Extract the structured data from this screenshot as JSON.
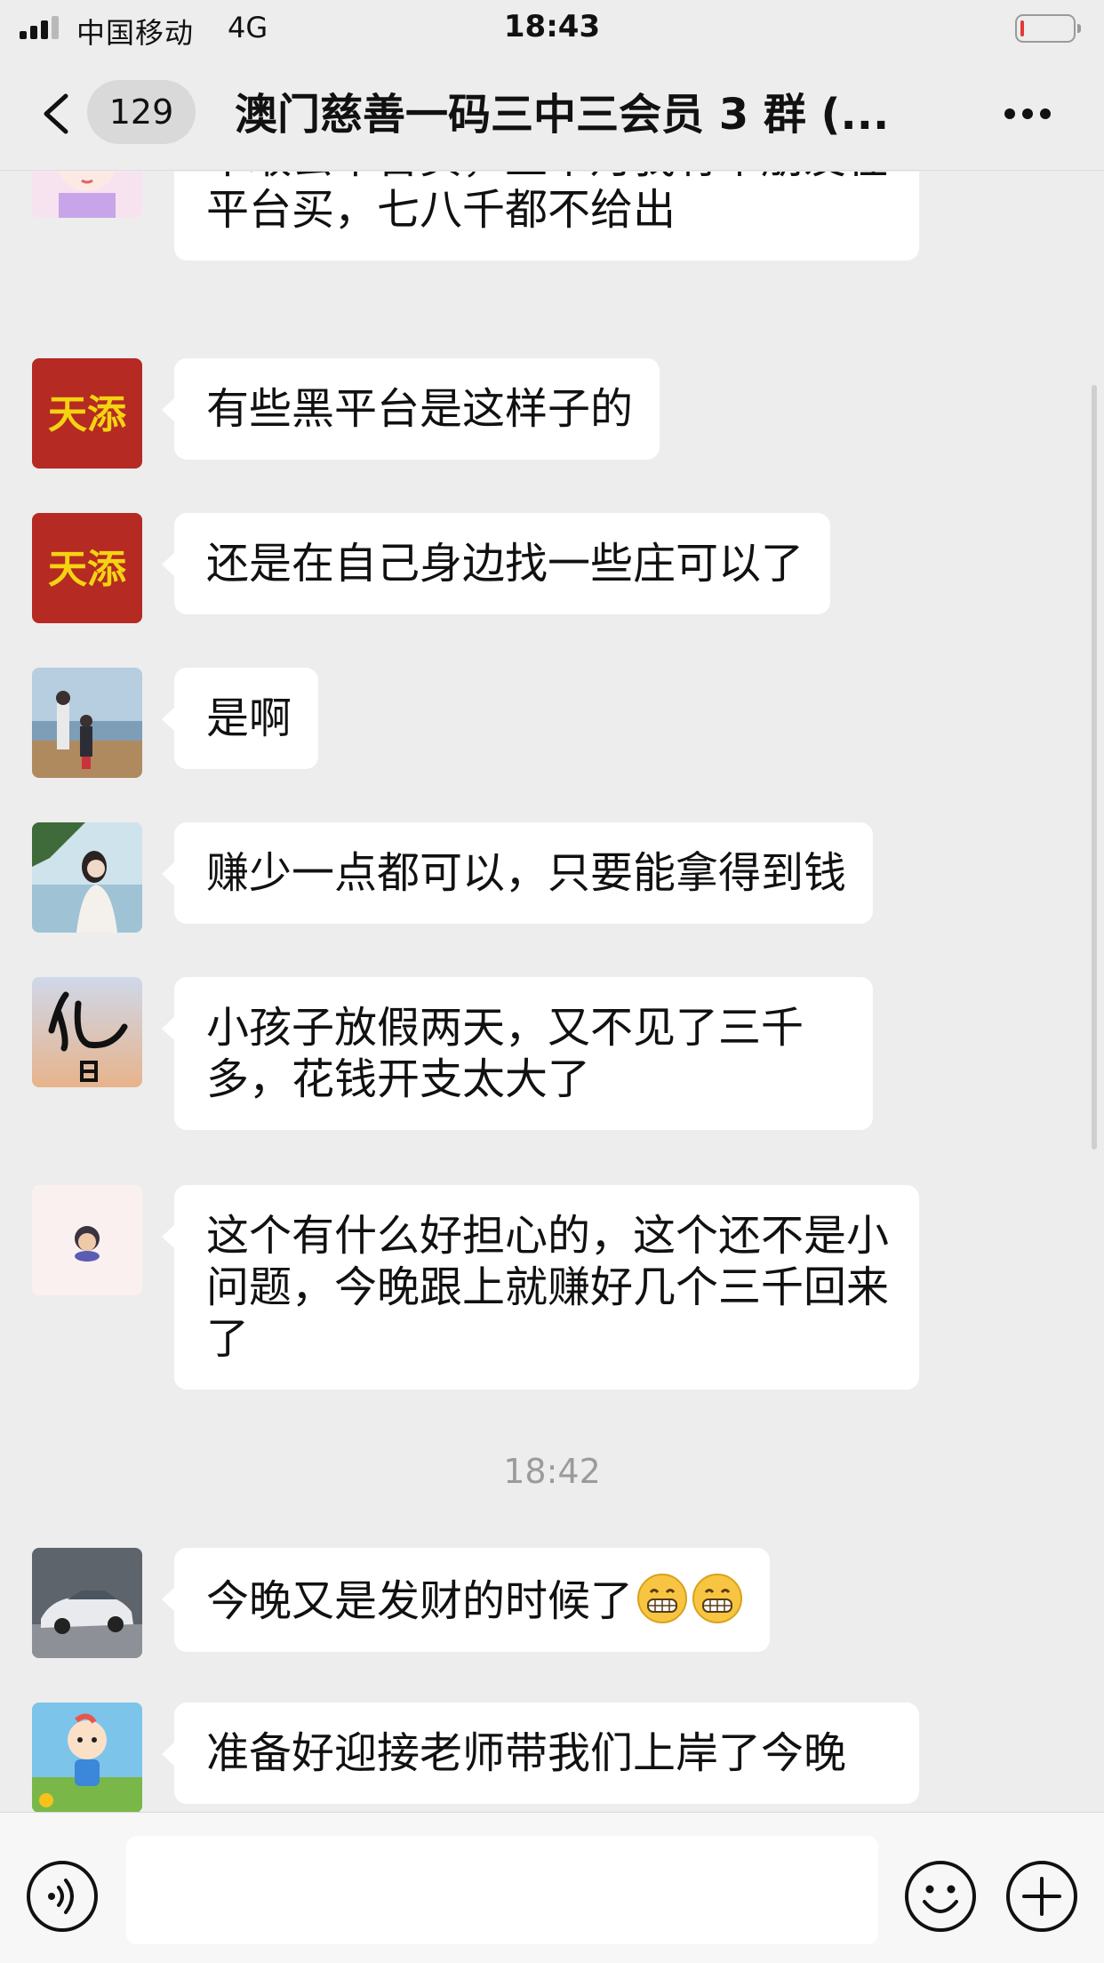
{
  "status_bar": {
    "carrier": "中国移动",
    "network": "4G",
    "time": "18:43",
    "battery_level": 0.08
  },
  "header": {
    "back_icon": "chevron-left-icon",
    "unread_count": "129",
    "title": "澳门慈善一码三中三会员 3 群 (...",
    "more_icon": "ellipsis-icon"
  },
  "messages": [
    {
      "avatar": "avatar-anime-girl",
      "text": "不敢去平台买，上个月我有个朋友在平台买，七八千都不给出"
    },
    {
      "avatar": "avatar-tiantian",
      "avatar_text": "天添",
      "text": "有些黑平台是这样子的"
    },
    {
      "avatar": "avatar-tiantian",
      "avatar_text": "天添",
      "text": "还是在自己身边找一些庄可以了"
    },
    {
      "avatar": "avatar-beach-family",
      "text": "是啊"
    },
    {
      "avatar": "avatar-woman-sea",
      "text": "赚少一点都可以，只要能拿得到钱"
    },
    {
      "avatar": "avatar-calligraphy",
      "text": "小孩子放假两天，又不见了三千多，花钱开支太大了"
    },
    {
      "avatar": "avatar-cartoon-face",
      "text": "这个有什么好担心的，这个还不是小问题，今晚跟上就赚好几个三千回来了"
    },
    {
      "avatar": "avatar-car",
      "text": "今晚又是发财的时候了",
      "emojis": [
        "grin-emoji",
        "grin-emoji"
      ]
    },
    {
      "avatar": "avatar-cartoon-baby",
      "text": "准备好迎接老师带我们上岸了今晚"
    }
  ],
  "timestamp": "18:42",
  "input_bar": {
    "voice_icon": "voice-icon",
    "placeholder": "",
    "emoji_icon": "smiley-icon",
    "plus_icon": "plus-icon"
  },
  "colors": {
    "background": "#ededed",
    "bubble": "#ffffff",
    "avatar_red": "#b52a22",
    "avatar_gold": "#f5d312"
  }
}
